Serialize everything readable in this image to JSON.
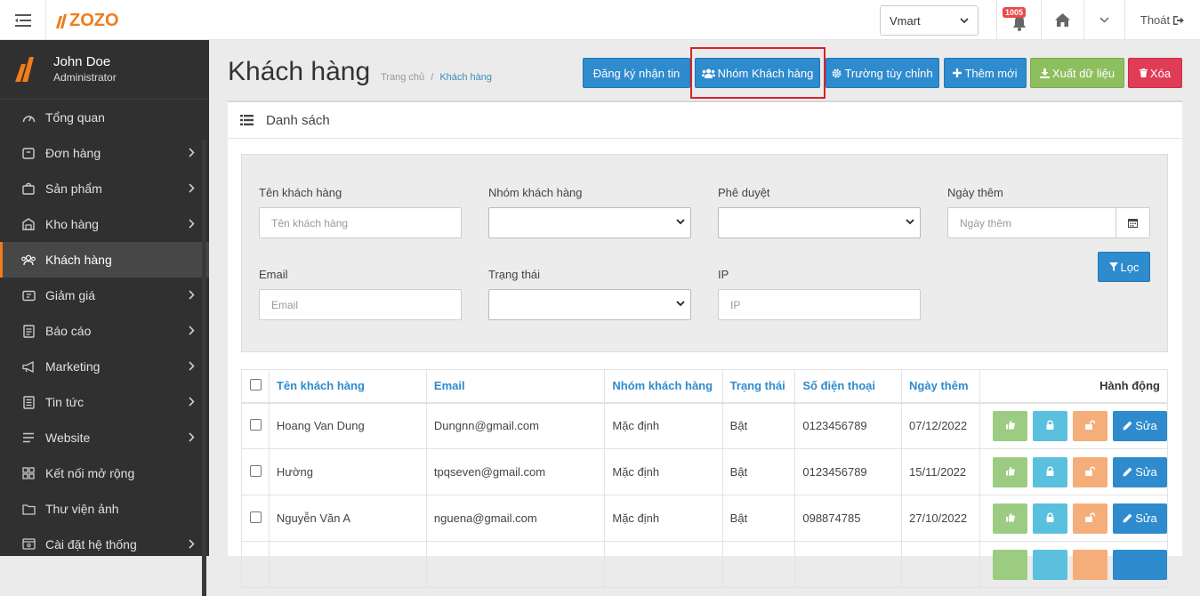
{
  "brand": {
    "logo_text": "ZOZO",
    "accent": "#f07c1b"
  },
  "topbar": {
    "store_selected": "Vmart",
    "notification_count": "1005",
    "logout_label": "Thoát"
  },
  "user": {
    "name": "John Doe",
    "role": "Administrator"
  },
  "sidebar": {
    "items": [
      {
        "label": "Tổng quan",
        "icon": "gauge-icon",
        "has_children": false
      },
      {
        "label": "Đơn hàng",
        "icon": "box-icon",
        "has_children": true
      },
      {
        "label": "Sản phẩm",
        "icon": "bag-icon",
        "has_children": true
      },
      {
        "label": "Kho hàng",
        "icon": "warehouse-icon",
        "has_children": true
      },
      {
        "label": "Khách hàng",
        "icon": "users-icon",
        "has_children": false,
        "active": true
      },
      {
        "label": "Giảm giá",
        "icon": "ticket-icon",
        "has_children": true
      },
      {
        "label": "Báo cáo",
        "icon": "report-icon",
        "has_children": true
      },
      {
        "label": "Marketing",
        "icon": "megaphone-icon",
        "has_children": true
      },
      {
        "label": "Tin tức",
        "icon": "news-icon",
        "has_children": true
      },
      {
        "label": "Website",
        "icon": "list-icon",
        "has_children": true
      },
      {
        "label": "Kết nối mở rộng",
        "icon": "grid-icon",
        "has_children": false
      },
      {
        "label": "Thư viện ảnh",
        "icon": "folder-icon",
        "has_children": false
      },
      {
        "label": "Cài đặt hệ thống",
        "icon": "gear-icon",
        "has_children": true
      }
    ]
  },
  "page": {
    "title": "Khách hàng",
    "breadcrumb": {
      "home": "Trang chủ",
      "separator": "/",
      "current": "Khách hàng"
    }
  },
  "toolbar": {
    "subscribe_label": "Đăng ký nhận tin",
    "groups_label": "Nhóm Khách hàng",
    "custom_fields_label": "Trường tùy chỉnh",
    "add_label": "Thêm mới",
    "export_label": "Xuất dữ liệu",
    "delete_label": "Xóa"
  },
  "panel": {
    "title": "Danh sách"
  },
  "filters": {
    "name": {
      "label": "Tên khách hàng",
      "placeholder": "Tên khách hàng",
      "value": ""
    },
    "group": {
      "label": "Nhóm khách hàng",
      "value": ""
    },
    "approval": {
      "label": "Phê duyệt",
      "value": ""
    },
    "date": {
      "label": "Ngày thêm",
      "placeholder": "Ngày thêm",
      "value": ""
    },
    "email": {
      "label": "Email",
      "placeholder": "Email",
      "value": ""
    },
    "status": {
      "label": "Trạng thái",
      "value": ""
    },
    "ip": {
      "label": "IP",
      "placeholder": "IP",
      "value": ""
    },
    "filter_button": "Lọc"
  },
  "table": {
    "headers": [
      "Tên khách hàng",
      "Email",
      "Nhóm khách hàng",
      "Trạng thái",
      "Số điện thoại",
      "Ngày thêm",
      "Hành động"
    ],
    "edit_label": "Sửa",
    "rows": [
      {
        "name": "Hoang Van Dung",
        "email": "Dungnn@gmail.com",
        "group": "Mặc định",
        "status": "Bật",
        "phone": "0123456789",
        "date": "07/12/2022"
      },
      {
        "name": "Hường",
        "email": "tpqseven@gmail.com",
        "group": "Mặc định",
        "status": "Bật",
        "phone": "0123456789",
        "date": "15/11/2022"
      },
      {
        "name": "Nguyễn Văn A",
        "email": "nguena@gmail.com",
        "group": "Mặc định",
        "status": "Bật",
        "phone": "098874785",
        "date": "27/10/2022"
      }
    ]
  }
}
